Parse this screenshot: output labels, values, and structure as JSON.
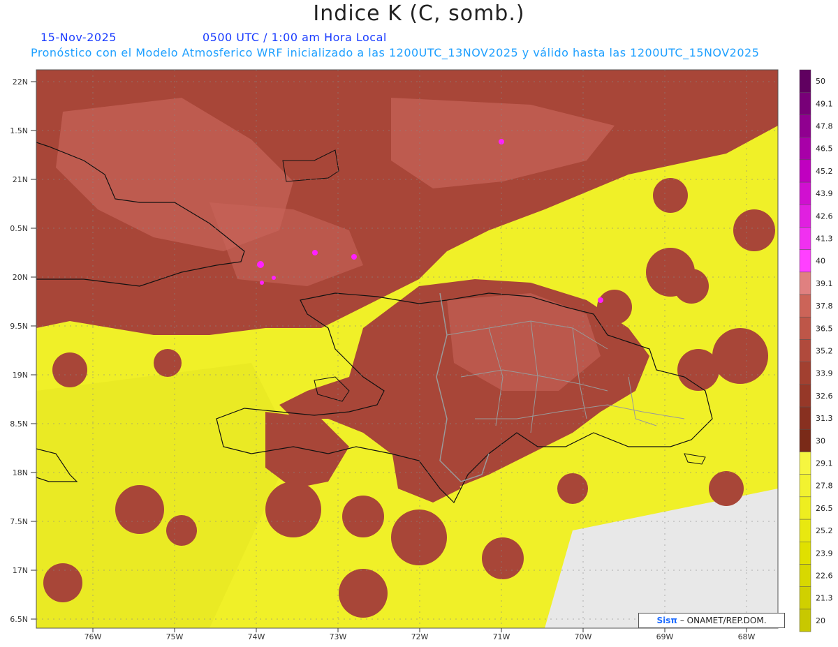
{
  "header": {
    "title": "Indice K (C, somb.)",
    "date": "15-Nov-2025",
    "time": "0500 UTC / 1:00 am Hora Local",
    "description": "Pronóstico con el Modelo Atmosferico WRF inicializado a las 1200UTC_13NOV2025 y válido hasta las  1200UTC_15NOV2025"
  },
  "axes": {
    "lat_labels": [
      "22N",
      "1.5N",
      "21N",
      "0.5N",
      "20N",
      "9.5N",
      "19N",
      "8.5N",
      "18N",
      "7.5N",
      "17N",
      "6.5N"
    ],
    "lon_labels": [
      "76W",
      "75W",
      "74W",
      "73W",
      "72W",
      "71W",
      "70W",
      "69W",
      "68W"
    ]
  },
  "colorbar": {
    "ticks": [
      "20",
      "21.3",
      "22.6",
      "23.9",
      "25.2",
      "26.5",
      "27.8",
      "29.1",
      "30",
      "31.3",
      "32.6",
      "33.9",
      "35.2",
      "36.5",
      "37.8",
      "39.1",
      "40",
      "41.3",
      "42.6",
      "43.9",
      "45.2",
      "46.5",
      "47.8",
      "49.1",
      "50"
    ],
    "colors": [
      "#c8c800",
      "#d0d000",
      "#d8d800",
      "#e0e000",
      "#e8e810",
      "#eeee20",
      "#f2f230",
      "#f6f640",
      "#7a2a18",
      "#883020",
      "#963828",
      "#a24030",
      "#b04a3c",
      "#be5648",
      "#cc6458",
      "#e08080",
      "#ff40ff",
      "#f030f0",
      "#e020e0",
      "#d010d0",
      "#c000c0",
      "#a800a8",
      "#900090",
      "#780078",
      "#600060"
    ]
  },
  "legend_colors": {
    "low_yellow": "#f0f028",
    "mid_brown": "#a84638",
    "high_salmon": "#c8645a",
    "magenta": "#ff20ff",
    "nodata": "#e8e8e8"
  },
  "credit": {
    "logo": "Sisπ",
    "text": "– ONAMET/REP.DOM."
  }
}
